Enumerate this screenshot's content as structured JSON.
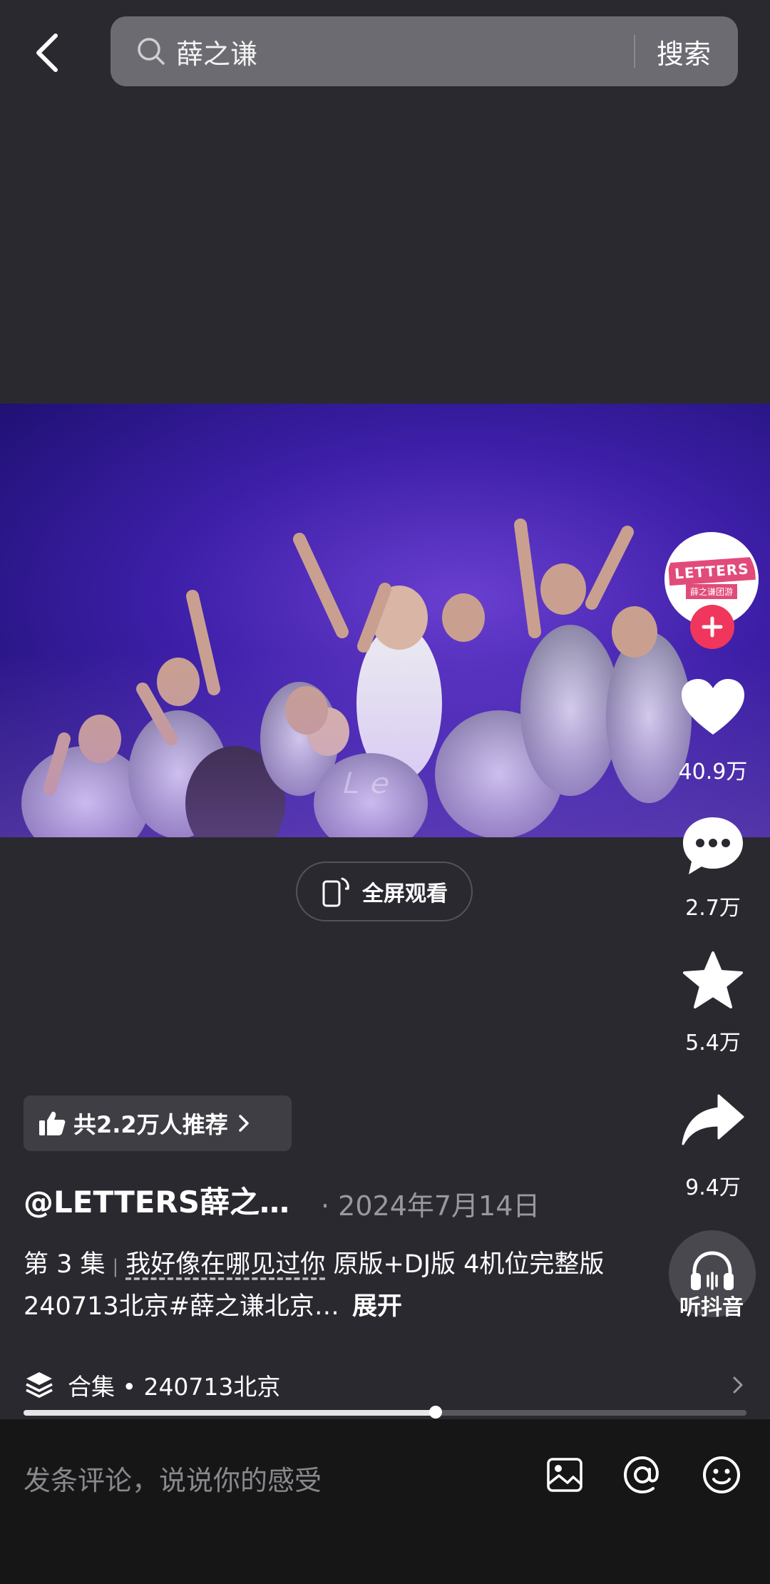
{
  "search": {
    "query": "薛之谦",
    "button_label": "搜索"
  },
  "video": {
    "watermark": "Ｌｅ"
  },
  "fullscreen": {
    "label": "全屏观看"
  },
  "sidebar": {
    "avatar": {
      "logo_text": "LETTERS",
      "logo_sub": "薛之谦团游"
    },
    "likes": "40.9万",
    "comments": "2.7万",
    "favorites": "5.4万",
    "shares": "9.4万",
    "listen_label": "听抖音"
  },
  "recommend": {
    "label": "共2.2万人推荐"
  },
  "post": {
    "author": "@LETTERS薛之…",
    "date": "· 2024年7月14日",
    "episode": "第 3 集",
    "separator": "|",
    "song": "我好像在哪见过你",
    "desc_rest": " 原版+DJ版 4机位完整版 240713北京#薛之谦北京…",
    "expand": "展开"
  },
  "collection": {
    "label": "合集 • 240713北京"
  },
  "playback": {
    "progress": 0.57
  },
  "comment": {
    "placeholder": "发条评论，说说你的感受"
  },
  "colors": {
    "accent": "#f0365c",
    "background": "#2b2930",
    "bar": "#161616"
  }
}
